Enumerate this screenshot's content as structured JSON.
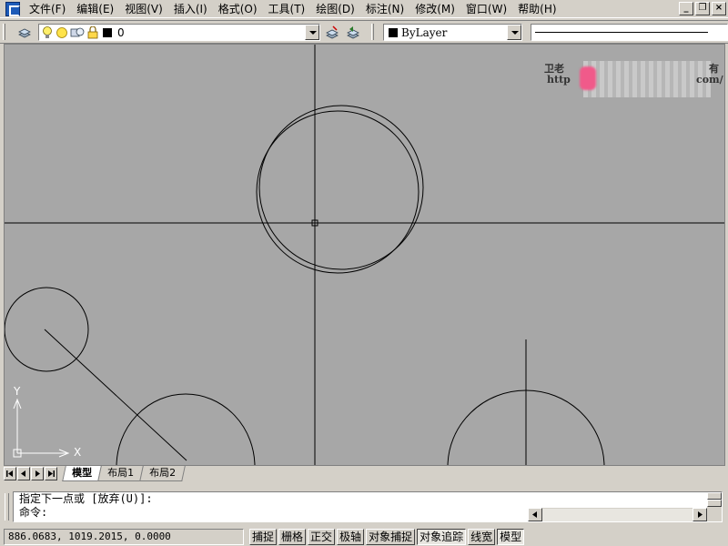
{
  "menu": {
    "items": [
      "文件(F)",
      "编辑(E)",
      "视图(V)",
      "插入(I)",
      "格式(O)",
      "工具(T)",
      "绘图(D)",
      "标注(N)",
      "修改(M)",
      "窗口(W)",
      "帮助(H)"
    ]
  },
  "toolbar": {
    "layer_value": "0",
    "color_value": "ByLayer"
  },
  "watermark": {
    "line1": "卫老",
    "line1_end": "有",
    "line2": "http",
    "line2_end": "com/"
  },
  "ucs": {
    "y_label": "Y",
    "x_label": "X"
  },
  "tabs": {
    "model": "模型",
    "layout1": "布局1",
    "layout2": "布局2"
  },
  "command": {
    "line1": "指定下一点或 [放弃(U)]:",
    "line2": "命令:"
  },
  "status": {
    "coordinates": "886.0683, 1019.2015, 0.0000",
    "buttons": [
      "捕捉",
      "栅格",
      "正交",
      "极轴",
      "对象捕捉",
      "对象追踪",
      "线宽",
      "模型"
    ],
    "active": [
      false,
      false,
      false,
      false,
      false,
      true,
      false,
      true
    ]
  },
  "colors": {
    "canvas": "#a7a7a7",
    "chrome": "#d4d0c8",
    "accent": "#1e5bb8"
  }
}
